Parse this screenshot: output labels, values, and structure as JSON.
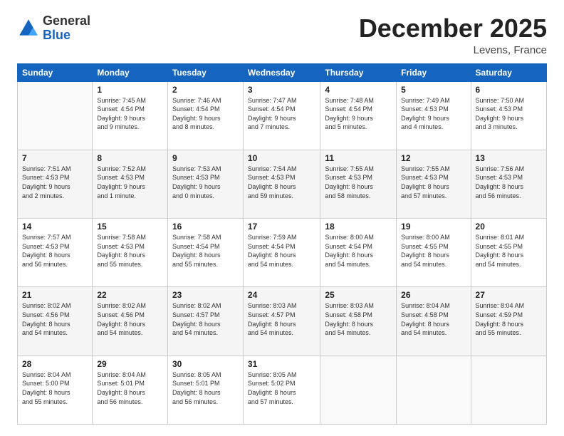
{
  "logo": {
    "general": "General",
    "blue": "Blue"
  },
  "title": "December 2025",
  "subtitle": "Levens, France",
  "days_header": [
    "Sunday",
    "Monday",
    "Tuesday",
    "Wednesday",
    "Thursday",
    "Friday",
    "Saturday"
  ],
  "weeks": [
    {
      "shaded": false,
      "days": [
        {
          "num": "",
          "info": ""
        },
        {
          "num": "1",
          "info": "Sunrise: 7:45 AM\nSunset: 4:54 PM\nDaylight: 9 hours\nand 9 minutes."
        },
        {
          "num": "2",
          "info": "Sunrise: 7:46 AM\nSunset: 4:54 PM\nDaylight: 9 hours\nand 8 minutes."
        },
        {
          "num": "3",
          "info": "Sunrise: 7:47 AM\nSunset: 4:54 PM\nDaylight: 9 hours\nand 7 minutes."
        },
        {
          "num": "4",
          "info": "Sunrise: 7:48 AM\nSunset: 4:54 PM\nDaylight: 9 hours\nand 5 minutes."
        },
        {
          "num": "5",
          "info": "Sunrise: 7:49 AM\nSunset: 4:53 PM\nDaylight: 9 hours\nand 4 minutes."
        },
        {
          "num": "6",
          "info": "Sunrise: 7:50 AM\nSunset: 4:53 PM\nDaylight: 9 hours\nand 3 minutes."
        }
      ]
    },
    {
      "shaded": true,
      "days": [
        {
          "num": "7",
          "info": "Sunrise: 7:51 AM\nSunset: 4:53 PM\nDaylight: 9 hours\nand 2 minutes."
        },
        {
          "num": "8",
          "info": "Sunrise: 7:52 AM\nSunset: 4:53 PM\nDaylight: 9 hours\nand 1 minute."
        },
        {
          "num": "9",
          "info": "Sunrise: 7:53 AM\nSunset: 4:53 PM\nDaylight: 9 hours\nand 0 minutes."
        },
        {
          "num": "10",
          "info": "Sunrise: 7:54 AM\nSunset: 4:53 PM\nDaylight: 8 hours\nand 59 minutes."
        },
        {
          "num": "11",
          "info": "Sunrise: 7:55 AM\nSunset: 4:53 PM\nDaylight: 8 hours\nand 58 minutes."
        },
        {
          "num": "12",
          "info": "Sunrise: 7:55 AM\nSunset: 4:53 PM\nDaylight: 8 hours\nand 57 minutes."
        },
        {
          "num": "13",
          "info": "Sunrise: 7:56 AM\nSunset: 4:53 PM\nDaylight: 8 hours\nand 56 minutes."
        }
      ]
    },
    {
      "shaded": false,
      "days": [
        {
          "num": "14",
          "info": "Sunrise: 7:57 AM\nSunset: 4:53 PM\nDaylight: 8 hours\nand 56 minutes."
        },
        {
          "num": "15",
          "info": "Sunrise: 7:58 AM\nSunset: 4:53 PM\nDaylight: 8 hours\nand 55 minutes."
        },
        {
          "num": "16",
          "info": "Sunrise: 7:58 AM\nSunset: 4:54 PM\nDaylight: 8 hours\nand 55 minutes."
        },
        {
          "num": "17",
          "info": "Sunrise: 7:59 AM\nSunset: 4:54 PM\nDaylight: 8 hours\nand 54 minutes."
        },
        {
          "num": "18",
          "info": "Sunrise: 8:00 AM\nSunset: 4:54 PM\nDaylight: 8 hours\nand 54 minutes."
        },
        {
          "num": "19",
          "info": "Sunrise: 8:00 AM\nSunset: 4:55 PM\nDaylight: 8 hours\nand 54 minutes."
        },
        {
          "num": "20",
          "info": "Sunrise: 8:01 AM\nSunset: 4:55 PM\nDaylight: 8 hours\nand 54 minutes."
        }
      ]
    },
    {
      "shaded": true,
      "days": [
        {
          "num": "21",
          "info": "Sunrise: 8:02 AM\nSunset: 4:56 PM\nDaylight: 8 hours\nand 54 minutes."
        },
        {
          "num": "22",
          "info": "Sunrise: 8:02 AM\nSunset: 4:56 PM\nDaylight: 8 hours\nand 54 minutes."
        },
        {
          "num": "23",
          "info": "Sunrise: 8:02 AM\nSunset: 4:57 PM\nDaylight: 8 hours\nand 54 minutes."
        },
        {
          "num": "24",
          "info": "Sunrise: 8:03 AM\nSunset: 4:57 PM\nDaylight: 8 hours\nand 54 minutes."
        },
        {
          "num": "25",
          "info": "Sunrise: 8:03 AM\nSunset: 4:58 PM\nDaylight: 8 hours\nand 54 minutes."
        },
        {
          "num": "26",
          "info": "Sunrise: 8:04 AM\nSunset: 4:58 PM\nDaylight: 8 hours\nand 54 minutes."
        },
        {
          "num": "27",
          "info": "Sunrise: 8:04 AM\nSunset: 4:59 PM\nDaylight: 8 hours\nand 55 minutes."
        }
      ]
    },
    {
      "shaded": false,
      "days": [
        {
          "num": "28",
          "info": "Sunrise: 8:04 AM\nSunset: 5:00 PM\nDaylight: 8 hours\nand 55 minutes."
        },
        {
          "num": "29",
          "info": "Sunrise: 8:04 AM\nSunset: 5:01 PM\nDaylight: 8 hours\nand 56 minutes."
        },
        {
          "num": "30",
          "info": "Sunrise: 8:05 AM\nSunset: 5:01 PM\nDaylight: 8 hours\nand 56 minutes."
        },
        {
          "num": "31",
          "info": "Sunrise: 8:05 AM\nSunset: 5:02 PM\nDaylight: 8 hours\nand 57 minutes."
        },
        {
          "num": "",
          "info": ""
        },
        {
          "num": "",
          "info": ""
        },
        {
          "num": "",
          "info": ""
        }
      ]
    }
  ]
}
